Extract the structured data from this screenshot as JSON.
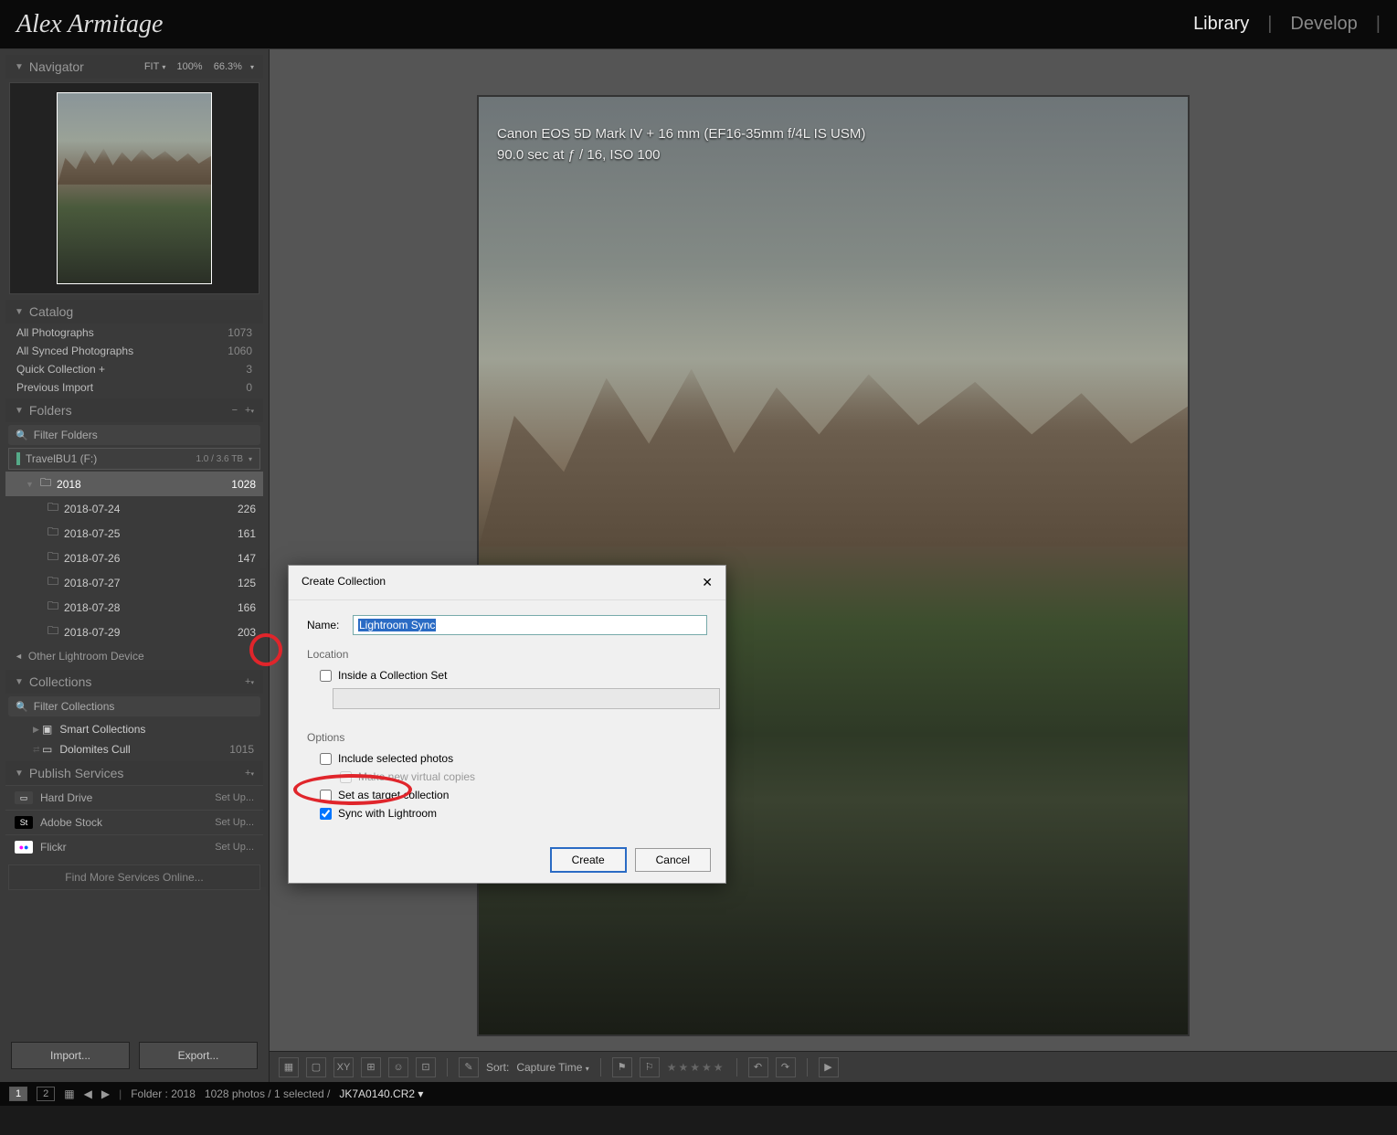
{
  "logo": "Alex Armitage",
  "modules": {
    "library": "Library",
    "develop": "Develop"
  },
  "navigator": {
    "title": "Navigator",
    "fit": "FIT",
    "zoom1": "100%",
    "zoom2": "66.3%"
  },
  "catalog": {
    "title": "Catalog",
    "rows": [
      {
        "label": "All Photographs",
        "count": "1073"
      },
      {
        "label": "All Synced Photographs",
        "count": "1060"
      },
      {
        "label": "Quick Collection  +",
        "count": "3"
      },
      {
        "label": "Previous Import",
        "count": "0"
      }
    ]
  },
  "folders": {
    "title": "Folders",
    "filter": "Filter Folders",
    "volume": {
      "name": "TravelBU1 (F:)",
      "space": "1.0 / 3.6 TB"
    },
    "root": {
      "name": "2018",
      "count": "1028"
    },
    "items": [
      {
        "name": "2018-07-24",
        "count": "226"
      },
      {
        "name": "2018-07-25",
        "count": "161"
      },
      {
        "name": "2018-07-26",
        "count": "147"
      },
      {
        "name": "2018-07-27",
        "count": "125"
      },
      {
        "name": "2018-07-28",
        "count": "166"
      },
      {
        "name": "2018-07-29",
        "count": "203"
      }
    ],
    "other": "Other Lightroom Device"
  },
  "collections": {
    "title": "Collections",
    "filter": "Filter Collections",
    "smart": "Smart Collections",
    "item": {
      "name": "Dolomites Cull",
      "count": "1015"
    }
  },
  "publish": {
    "title": "Publish Services",
    "rows": [
      {
        "icon": "hd",
        "name": "Hard Drive",
        "action": "Set Up..."
      },
      {
        "icon": "St",
        "name": "Adobe Stock",
        "action": "Set Up..."
      },
      {
        "icon": "fl",
        "name": "Flickr",
        "action": "Set Up..."
      }
    ],
    "find": "Find More Services Online..."
  },
  "buttons": {
    "import": "Import...",
    "export": "Export..."
  },
  "overlay": {
    "line1": "Canon EOS 5D Mark IV + 16 mm (EF16-35mm f/4L IS USM)",
    "line2": "90.0 sec at ƒ / 16, ISO 100"
  },
  "toolbar": {
    "sort": "Sort:",
    "sortval": "Capture Time"
  },
  "dialog": {
    "title": "Create Collection",
    "name_lbl": "Name:",
    "name_val": "Lightroom Sync",
    "location": "Location",
    "inside": "Inside a Collection Set",
    "options": "Options",
    "include": "Include selected photos",
    "virtual": "Make new virtual copies",
    "target": "Set as target collection",
    "sync": "Sync with Lightroom",
    "create": "Create",
    "cancel": "Cancel"
  },
  "status": {
    "p1": "1",
    "p2": "2",
    "folder": "Folder : 2018",
    "count": "1028 photos / 1 selected /",
    "file": "JK7A0140.CR2"
  }
}
